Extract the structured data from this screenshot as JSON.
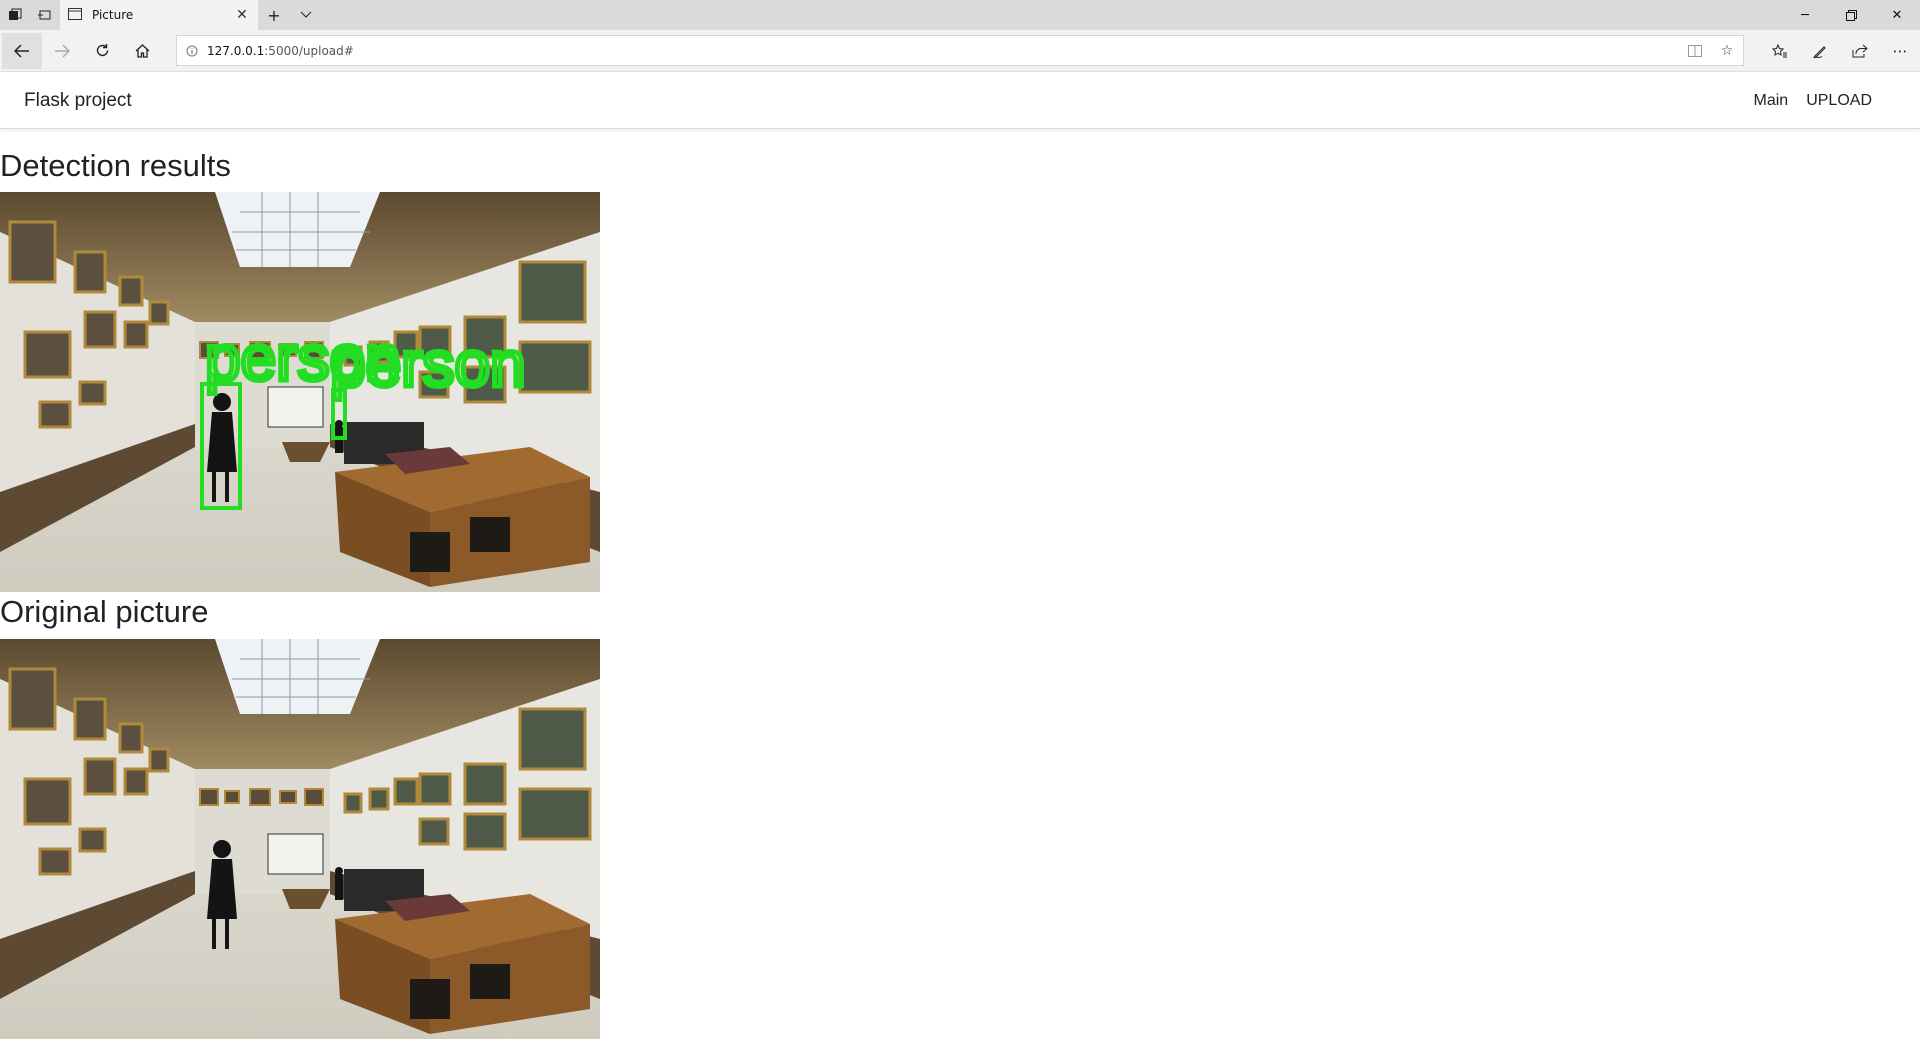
{
  "browser": {
    "tab_title": "Picture",
    "url_host": "127.0.0.1",
    "url_path": ":5000/upload#"
  },
  "header": {
    "brand": "Flask project",
    "nav": [
      {
        "label": "Main"
      },
      {
        "label": "UPLOAD"
      }
    ]
  },
  "sections": {
    "detection_title": "Detection results",
    "original_title": "Original picture"
  },
  "detections": [
    {
      "label": "person"
    },
    {
      "label": "person"
    }
  ],
  "colors": {
    "box": "#22dd22"
  }
}
